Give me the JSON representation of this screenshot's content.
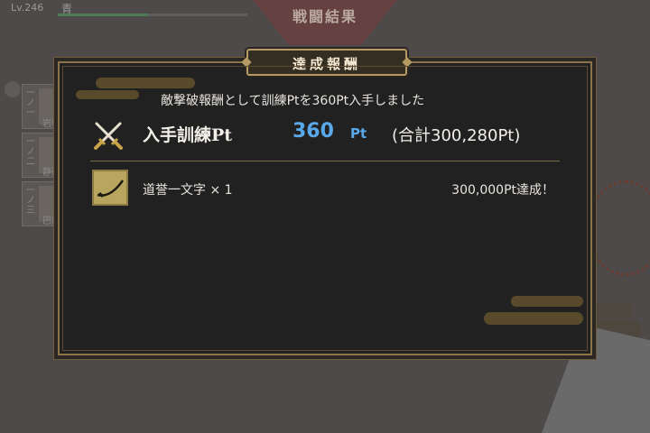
{
  "background": {
    "level": "Lv.246",
    "team_name": "青",
    "screen_title": "戦闘結果",
    "units": [
      {
        "number": "一ノ一",
        "name": "岩融"
      },
      {
        "number": "一ノ二",
        "name": "静形"
      },
      {
        "number": "一ノ三",
        "name": "巴形"
      }
    ]
  },
  "dialog": {
    "title": "達成報酬",
    "message": "敵撃破報酬として訓練Ptを360Pt入手しました",
    "earned": {
      "icon": "crossed-swords-icon",
      "label": "入手訓練Pt",
      "value": "360",
      "unit": "Pt",
      "total_text": "(合計300,280Pt)"
    },
    "reward_item": {
      "icon": "sword-item-icon",
      "name": "道誉一文字 × 1",
      "achievement": "300,000Pt達成！"
    }
  },
  "colors": {
    "accent_gold": "#b59a63",
    "value_blue": "#58a8ea",
    "panel_bg": "#222121"
  }
}
